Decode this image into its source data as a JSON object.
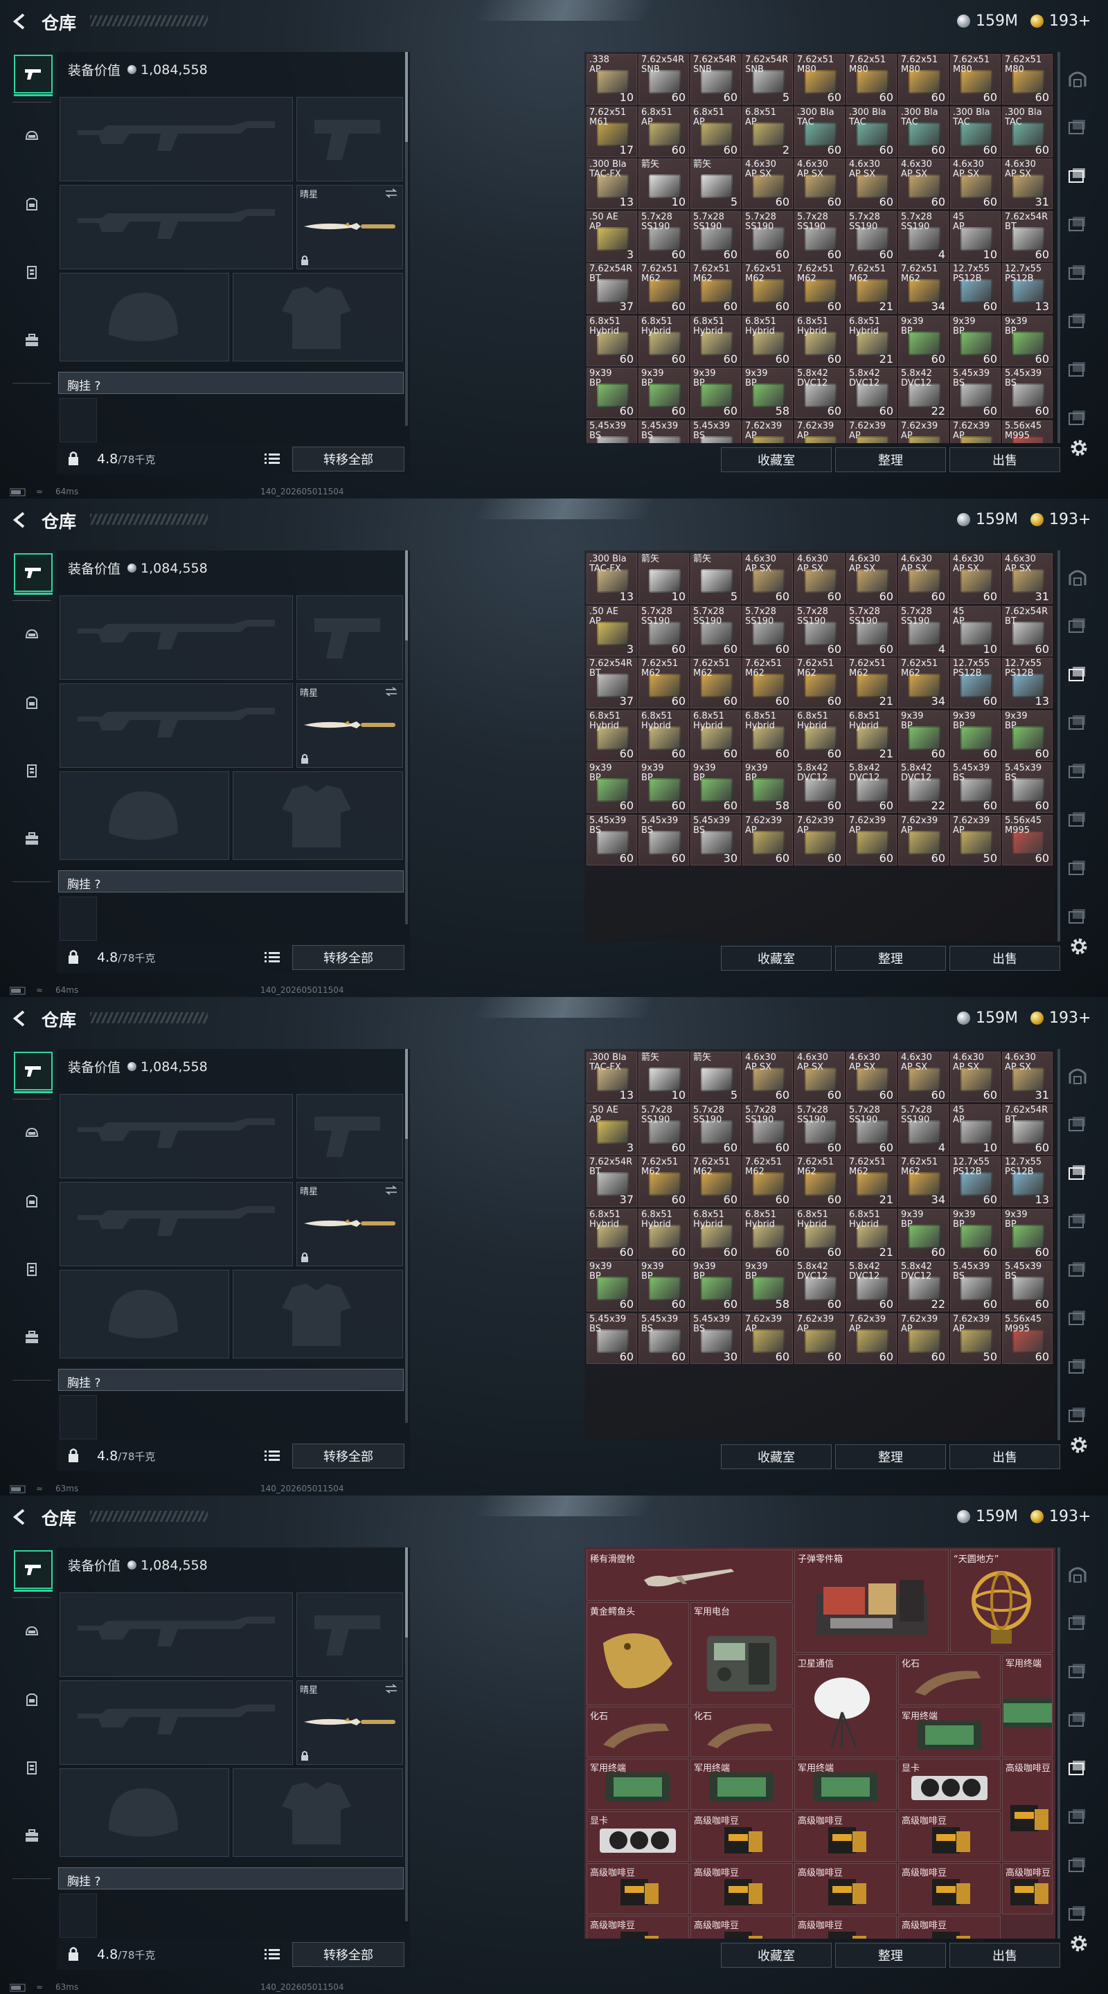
{
  "header": {
    "title": "仓库",
    "silver": "159M",
    "gold": "193+"
  },
  "left": {
    "equip_label": "装备价值",
    "equip_value": "1,084,558",
    "melee_name": "晴星",
    "vest_label": "胸挂 ?",
    "weight": "4.8",
    "weight_max": "/78千克",
    "transfer_all": "转移全部"
  },
  "buttons": {
    "collection": "收藏室",
    "organize": "整理",
    "sell": "出售"
  },
  "status": {
    "screens": [
      {
        "ping": "64ms",
        "build": "140_202605011504"
      },
      {
        "ping": "64ms",
        "build": "140_202605011504"
      },
      {
        "ping": "63ms",
        "build": "140_202605011504"
      },
      {
        "ping": "63ms",
        "build": "140_202605011504"
      }
    ]
  },
  "ammo_rows": [
    [
      {
        "name": ".338\nAP",
        "count": "10",
        "color": "#c9b27a"
      },
      {
        "name": "7.62x54R\nSNB",
        "count": "60",
        "color": "#c8c8c8"
      },
      {
        "name": "7.62x54R\nSNB",
        "count": "60",
        "color": "#c8c8c8"
      },
      {
        "name": "7.62x54R\nSNB",
        "count": "5",
        "color": "#c8c8c8"
      },
      {
        "name": "7.62x51\nM80",
        "count": "60",
        "color": "#d9a94a"
      },
      {
        "name": "7.62x51\nM80",
        "count": "60",
        "color": "#d9a94a"
      },
      {
        "name": "7.62x51\nM80",
        "count": "60",
        "color": "#d9a94a"
      },
      {
        "name": "7.62x51\nM80",
        "count": "60",
        "color": "#d9a94a"
      },
      {
        "name": "7.62x51\nM80",
        "count": "60",
        "color": "#d9a94a"
      }
    ],
    [
      {
        "name": "7.62x51\nM61",
        "count": "17",
        "color": "#c9a74a"
      },
      {
        "name": "6.8x51\nAP",
        "count": "60",
        "color": "#c6b36a"
      },
      {
        "name": "6.8x51\nAP",
        "count": "60",
        "color": "#c6b36a"
      },
      {
        "name": "6.8x51\nAP",
        "count": "2",
        "color": "#c6b36a"
      },
      {
        "name": ".300 Bla\nTAC",
        "count": "60",
        "color": "#6fb3a3"
      },
      {
        "name": ".300 Bla\nTAC",
        "count": "60",
        "color": "#6fb3a3"
      },
      {
        "name": ".300 Bla\nTAC",
        "count": "60",
        "color": "#6fb3a3"
      },
      {
        "name": ".300 Bla\nTAC",
        "count": "60",
        "color": "#6fb3a3"
      },
      {
        "name": ".300 Bla\nTAC",
        "count": "60",
        "color": "#6fb3a3"
      }
    ],
    [
      {
        "name": ".300 Bla\nTAC-FX",
        "count": "13",
        "color": "#d1b780"
      },
      {
        "name": "箭矢",
        "count": "10",
        "color": "#e6e6e6"
      },
      {
        "name": "箭矢",
        "count": "5",
        "color": "#e6e6e6"
      },
      {
        "name": "4.6x30\nAP SX",
        "count": "60",
        "color": "#c9a86a"
      },
      {
        "name": "4.6x30\nAP SX",
        "count": "60",
        "color": "#c9a86a"
      },
      {
        "name": "4.6x30\nAP SX",
        "count": "60",
        "color": "#c9a86a"
      },
      {
        "name": "4.6x30\nAP SX",
        "count": "60",
        "color": "#c9a86a"
      },
      {
        "name": "4.6x30\nAP SX",
        "count": "60",
        "color": "#c9a86a"
      },
      {
        "name": "4.6x30\nAP SX",
        "count": "31",
        "color": "#c9a86a"
      }
    ],
    [
      {
        "name": ".50 AE\nAP",
        "count": "3",
        "color": "#d8c05a"
      },
      {
        "name": "5.7x28\nSS190",
        "count": "60",
        "color": "#b8b8b8"
      },
      {
        "name": "5.7x28\nSS190",
        "count": "60",
        "color": "#b8b8b8"
      },
      {
        "name": "5.7x28\nSS190",
        "count": "60",
        "color": "#b8b8b8"
      },
      {
        "name": "5.7x28\nSS190",
        "count": "60",
        "color": "#b8b8b8"
      },
      {
        "name": "5.7x28\nSS190",
        "count": "60",
        "color": "#b8b8b8"
      },
      {
        "name": "5.7x28\nSS190",
        "count": "4",
        "color": "#b8b8b8"
      },
      {
        "name": "45\nAP",
        "count": "10",
        "color": "#c2c2c2"
      },
      {
        "name": "7.62x54R\nBT",
        "count": "60",
        "color": "#d0d0d0"
      }
    ],
    [
      {
        "name": "7.62x54R\nBT",
        "count": "37",
        "color": "#c8c8c8"
      },
      {
        "name": "7.62x51\nM62",
        "count": "60",
        "color": "#d9a94a"
      },
      {
        "name": "7.62x51\nM62",
        "count": "60",
        "color": "#d9a94a"
      },
      {
        "name": "7.62x51\nM62",
        "count": "60",
        "color": "#d9a94a"
      },
      {
        "name": "7.62x51\nM62",
        "count": "60",
        "color": "#d9a94a"
      },
      {
        "name": "7.62x51\nM62",
        "count": "21",
        "color": "#d9a94a"
      },
      {
        "name": "7.62x51\nM62",
        "count": "34",
        "color": "#d9a94a"
      },
      {
        "name": "12.7x55\nPS12B",
        "count": "60",
        "color": "#7fb2c9"
      },
      {
        "name": "12.7x55\nPS12B",
        "count": "13",
        "color": "#7fb2c9"
      }
    ],
    [
      {
        "name": "6.8x51\nHybrid",
        "count": "60",
        "color": "#cdbb7a"
      },
      {
        "name": "6.8x51\nHybrid",
        "count": "60",
        "color": "#cdbb7a"
      },
      {
        "name": "6.8x51\nHybrid",
        "count": "60",
        "color": "#cdbb7a"
      },
      {
        "name": "6.8x51\nHybrid",
        "count": "60",
        "color": "#cdbb7a"
      },
      {
        "name": "6.8x51\nHybrid",
        "count": "60",
        "color": "#cdbb7a"
      },
      {
        "name": "6.8x51\nHybrid",
        "count": "21",
        "color": "#cdbb7a"
      },
      {
        "name": "9x39\nBP",
        "count": "60",
        "color": "#7ec46a"
      },
      {
        "name": "9x39\nBP",
        "count": "60",
        "color": "#7ec46a"
      },
      {
        "name": "9x39\nBP",
        "count": "60",
        "color": "#7ec46a"
      }
    ],
    [
      {
        "name": "9x39\nBP",
        "count": "60",
        "color": "#7ec46a"
      },
      {
        "name": "9x39\nBP",
        "count": "60",
        "color": "#7ec46a"
      },
      {
        "name": "9x39\nBP",
        "count": "60",
        "color": "#7ec46a"
      },
      {
        "name": "9x39\nBP",
        "count": "58",
        "color": "#7ec46a"
      },
      {
        "name": "5.8x42\nDVC12",
        "count": "60",
        "color": "#c8c8c8"
      },
      {
        "name": "5.8x42\nDVC12",
        "count": "60",
        "color": "#c8c8c8"
      },
      {
        "name": "5.8x42\nDVC12",
        "count": "22",
        "color": "#c8c8c8"
      },
      {
        "name": "5.45x39\nBS",
        "count": "60",
        "color": "#c8c8c8"
      },
      {
        "name": "5.45x39\nBS",
        "count": "60",
        "color": "#c8c8c8"
      }
    ],
    [
      {
        "name": "5.45x39\nBS",
        "count": "60",
        "color": "#c8c8c8"
      },
      {
        "name": "5.45x39\nBS",
        "count": "60",
        "color": "#c8c8c8"
      },
      {
        "name": "5.45x39\nBS",
        "count": "30",
        "color": "#c8c8c8"
      },
      {
        "name": "7.62x39\nAP",
        "count": "60",
        "color": "#c6b060"
      },
      {
        "name": "7.62x39\nAP",
        "count": "60",
        "color": "#c6b060"
      },
      {
        "name": "7.62x39\nAP",
        "count": "60",
        "color": "#c6b060"
      },
      {
        "name": "7.62x39\nAP",
        "count": "60",
        "color": "#c6b060"
      },
      {
        "name": "7.62x39\nAP",
        "count": "50",
        "color": "#c6b060"
      },
      {
        "name": "5.56x45\nM995",
        "count": "60",
        "color": "#c0504a"
      }
    ]
  ],
  "collectibles": [
    {
      "name": "稀有滑膛枪",
      "col": 0,
      "row": 0,
      "w": 4,
      "h": 1,
      "art": "gun"
    },
    {
      "name": "子弹零件箱",
      "col": 4,
      "row": 0,
      "w": 3,
      "h": 2,
      "art": "crate"
    },
    {
      "name": "“天圆地方”",
      "col": 7,
      "row": 0,
      "w": 2,
      "h": 2,
      "art": "sphere"
    },
    {
      "name": "黄金鳄鱼头",
      "col": 0,
      "row": 1,
      "w": 2,
      "h": 2,
      "art": "croc"
    },
    {
      "name": "军用电台",
      "col": 2,
      "row": 1,
      "w": 2,
      "h": 2,
      "art": "radio"
    },
    {
      "name": "卫星通信",
      "col": 4,
      "row": 2,
      "w": 2,
      "h": 2,
      "art": "dish"
    },
    {
      "name": "化石",
      "col": 6,
      "row": 2,
      "w": 2,
      "h": 1,
      "art": "fossil"
    },
    {
      "name": "军用终端",
      "col": 8,
      "row": 2,
      "w": 1,
      "h": 2,
      "art": "terminal"
    },
    {
      "name": "化石",
      "col": 0,
      "row": 3,
      "w": 2,
      "h": 1,
      "art": "fossil"
    },
    {
      "name": "化石",
      "col": 2,
      "row": 3,
      "w": 2,
      "h": 1,
      "art": "fossil"
    },
    {
      "name": "军用终端",
      "col": 6,
      "row": 3,
      "w": 2,
      "h": 1,
      "art": "terminal"
    },
    {
      "name": "军用终端",
      "col": 0,
      "row": 4,
      "w": 2,
      "h": 1,
      "art": "terminal"
    },
    {
      "name": "军用终端",
      "col": 2,
      "row": 4,
      "w": 2,
      "h": 1,
      "art": "terminal"
    },
    {
      "name": "军用终端",
      "col": 4,
      "row": 4,
      "w": 2,
      "h": 1,
      "art": "terminal"
    },
    {
      "name": "显卡",
      "col": 6,
      "row": 4,
      "w": 2,
      "h": 1,
      "art": "gpu"
    },
    {
      "name": "高级咖啡豆",
      "col": 8,
      "row": 4,
      "w": 1,
      "h": 2,
      "art": "coffee"
    },
    {
      "name": "显卡",
      "col": 0,
      "row": 5,
      "w": 2,
      "h": 1,
      "art": "gpu"
    },
    {
      "name": "高级咖啡豆",
      "col": 2,
      "row": 5,
      "w": 2,
      "h": 1,
      "art": "coffee"
    },
    {
      "name": "高级咖啡豆",
      "col": 4,
      "row": 5,
      "w": 2,
      "h": 1,
      "art": "coffee"
    },
    {
      "name": "高级咖啡豆",
      "col": 6,
      "row": 5,
      "w": 2,
      "h": 1,
      "art": "coffee"
    },
    {
      "name": "高级咖啡豆",
      "col": 0,
      "row": 6,
      "w": 2,
      "h": 1,
      "art": "coffee"
    },
    {
      "name": "高级咖啡豆",
      "col": 2,
      "row": 6,
      "w": 2,
      "h": 1,
      "art": "coffee"
    },
    {
      "name": "高级咖啡豆",
      "col": 4,
      "row": 6,
      "w": 2,
      "h": 1,
      "art": "coffee"
    },
    {
      "name": "高级咖啡豆",
      "col": 6,
      "row": 6,
      "w": 2,
      "h": 1,
      "art": "coffee"
    },
    {
      "name": "高级咖啡豆",
      "col": 8,
      "row": 6,
      "w": 1,
      "h": 1,
      "art": "coffee"
    },
    {
      "name": "高级咖啡豆",
      "col": 0,
      "row": 7,
      "w": 2,
      "h": 1,
      "art": "coffee"
    },
    {
      "name": "高级咖啡豆",
      "col": 2,
      "row": 7,
      "w": 2,
      "h": 1,
      "art": "coffee"
    },
    {
      "name": "高级咖啡豆",
      "col": 4,
      "row": 7,
      "w": 2,
      "h": 1,
      "art": "coffee"
    },
    {
      "name": "高级咖啡豆",
      "col": 6,
      "row": 7,
      "w": 2,
      "h": 1,
      "art": "coffee"
    }
  ]
}
